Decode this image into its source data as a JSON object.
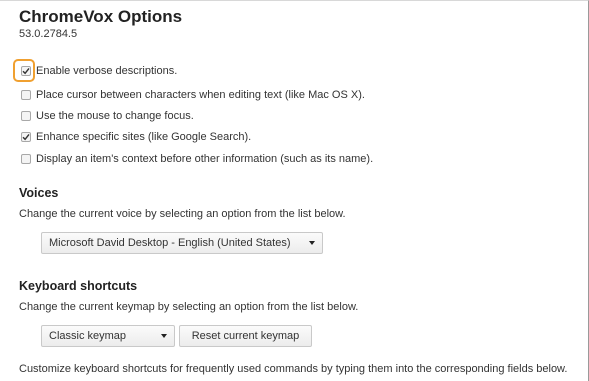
{
  "header": {
    "title": "ChromeVox Options",
    "version": "53.0.2784.5"
  },
  "options": [
    {
      "label": "Enable verbose descriptions.",
      "checked": true
    },
    {
      "label": "Place cursor between characters when editing text (like Mac OS X).",
      "checked": false
    },
    {
      "label": "Use the mouse to change focus.",
      "checked": false
    },
    {
      "label": "Enhance specific sites (like Google Search).",
      "checked": true
    },
    {
      "label": "Display an item's context before other information (such as its name).",
      "checked": false
    }
  ],
  "voices": {
    "heading": "Voices",
    "description": "Change the current voice by selecting an option from the list below.",
    "selected": "Microsoft David Desktop - English (United States)"
  },
  "keyboard": {
    "heading": "Keyboard shortcuts",
    "description": "Change the current keymap by selecting an option from the list below.",
    "selected_keymap": "Classic keymap",
    "reset_label": "Reset current keymap",
    "customize_text": "Customize keyboard shortcuts for frequently used commands by typing them into the corresponding fields below."
  },
  "colors": {
    "focus_ring": "#f0a030",
    "text": "#333333"
  },
  "icons": {
    "check": "check-icon",
    "dropdown": "chevron-down-icon"
  }
}
